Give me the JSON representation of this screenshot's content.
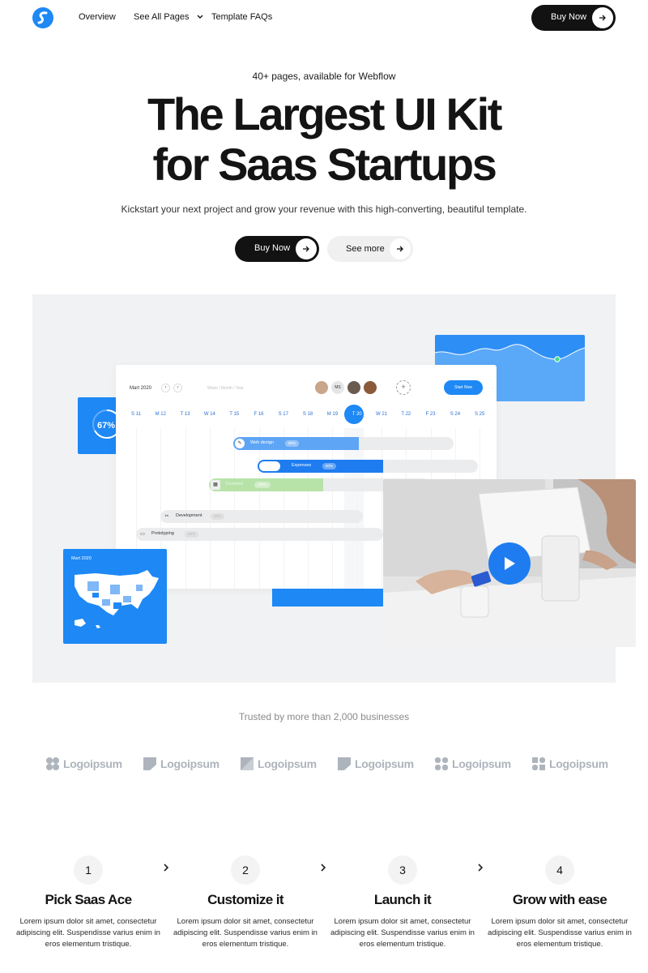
{
  "nav": {
    "links": [
      "Overview",
      "See All Pages",
      "Template FAQs"
    ],
    "buy_label": "Buy Now"
  },
  "hero": {
    "eyebrow": "40+ pages, available for Webflow",
    "headline_line1": "The Largest UI Kit",
    "headline_line2": "for Saas Startups",
    "subline": "Kickstart your next project and grow your revenue with this high-converting, beautiful template.",
    "primary_cta": "Buy Now",
    "secondary_cta": "See more"
  },
  "mockup": {
    "stat_card": {
      "value": "67%",
      "progress": 0.67
    },
    "gantt": {
      "month": "Mart 2020",
      "views": "Week  /  Month  /  Year",
      "assignee_initials": "MS",
      "start_label": "Start Now",
      "days": [
        "S 11",
        "M 12",
        "T 13",
        "W 14",
        "T 15",
        "F 16",
        "S 17",
        "S 18",
        "M 19",
        "T 20",
        "W 21",
        "T 22",
        "F 23",
        "S 24",
        "S 25"
      ],
      "active_day": "T 20",
      "tasks": [
        {
          "name": "Web design",
          "badge": "60%",
          "progress": 0.57
        },
        {
          "name": "Expenses",
          "badge": "60%",
          "progress": 0.57
        },
        {
          "name": "Finished",
          "badge": "100%",
          "progress": 0.52
        },
        {
          "name": "Development",
          "badge": "40%",
          "progress": 0
        },
        {
          "name": "Prototyping",
          "badge": "60%",
          "progress": 0
        }
      ]
    },
    "map_card": {
      "label": "Mart 2020"
    }
  },
  "trust": {
    "caption": "Trusted by more than 2,000 businesses",
    "logos": [
      "Logoipsum",
      "Logoipsum",
      "Logoipsum",
      "Logoipsum",
      "Logoipsum",
      "Logoipsum"
    ]
  },
  "steps": [
    {
      "num": "1",
      "title": "Pick Saas Ace",
      "desc": "Lorem ipsum dolor sit amet, consectetur adipiscing elit. Suspendisse varius enim in eros elementum tristique."
    },
    {
      "num": "2",
      "title": "Customize it",
      "desc": "Lorem ipsum dolor sit amet, consectetur adipiscing elit. Suspendisse varius enim in eros elementum tristique."
    },
    {
      "num": "3",
      "title": "Launch it",
      "desc": "Lorem ipsum dolor sit amet, consectetur adipiscing elit. Suspendisse varius enim in eros elementum tristique."
    },
    {
      "num": "4",
      "title": "Grow with ease",
      "desc": "Lorem ipsum dolor sit amet, consectetur adipiscing elit. Suspendisse varius enim in eros elementum tristique."
    }
  ],
  "colors": {
    "accent": "#1e88f5",
    "dark": "#121212",
    "mock_bg": "#f1f2f4",
    "logo_gray": "#aeb4bc"
  }
}
